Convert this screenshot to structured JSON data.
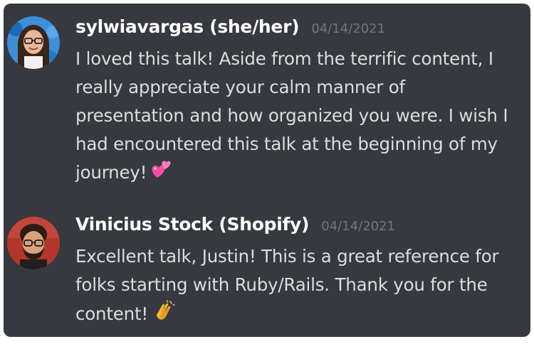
{
  "messages": [
    {
      "username": "sylwiavargas (she/her)",
      "timestamp": "04/14/2021",
      "text": "I loved this talk! Aside from the terrific content, I really appreciate your calm manner of presentation and how organized you were. I wish I had encountered this talk at the beginning of my journey!",
      "emoji": "two-hearts-icon"
    },
    {
      "username": "Vinicius Stock (Shopify)",
      "timestamp": "04/14/2021",
      "text": "Excellent talk, Justin! This is a great reference for folks starting with Ruby/Rails. Thank you for the content!",
      "emoji": "clapping-hands-icon"
    }
  ],
  "colors": {
    "background": "#36393f",
    "username": "#ffffff",
    "timestamp": "#72767d",
    "message_text": "#dcddde"
  }
}
